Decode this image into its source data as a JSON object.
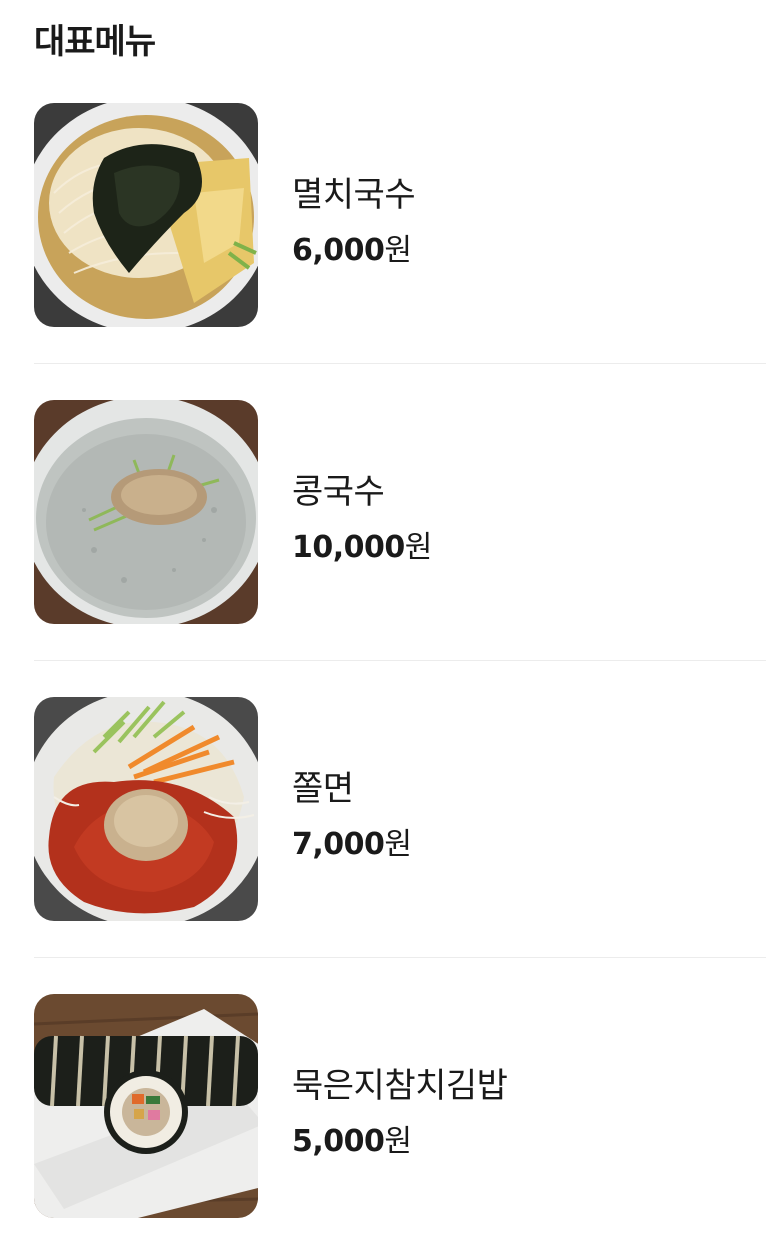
{
  "section": {
    "title": "대표메뉴"
  },
  "menu": {
    "items": [
      {
        "name": "멸치국수",
        "price": "6,000",
        "unit": "원",
        "image_icon": "anchovy-noodle-photo"
      },
      {
        "name": "콩국수",
        "price": "10,000",
        "unit": "원",
        "image_icon": "soybean-noodle-photo"
      },
      {
        "name": "쫄면",
        "price": "7,000",
        "unit": "원",
        "image_icon": "spicy-chewy-noodle-photo"
      },
      {
        "name": "묵은지참치김밥",
        "price": "5,000",
        "unit": "원",
        "image_icon": "kimchi-tuna-gimbap-photo"
      }
    ]
  },
  "colors": {
    "text": "#1a1a1a",
    "divider": "#ececec",
    "background": "#ffffff"
  }
}
